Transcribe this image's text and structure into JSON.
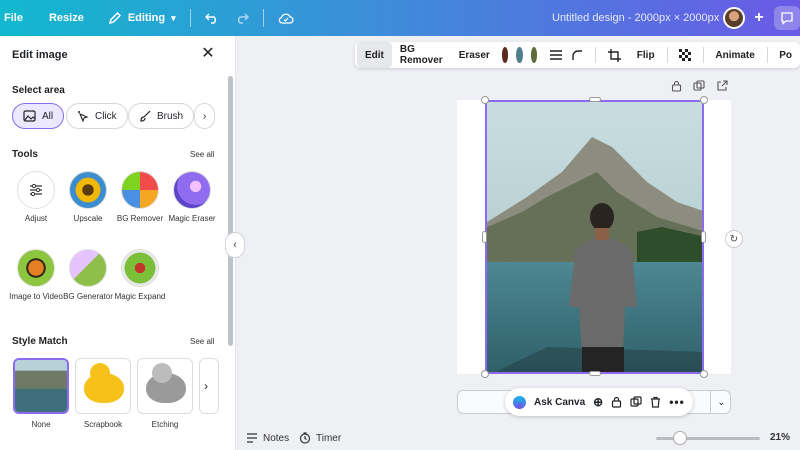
{
  "topbar": {
    "file": "File",
    "resize": "Resize",
    "editing": "Editing",
    "title": "Untitled design - 2000px × 2000px"
  },
  "panel": {
    "title": "Edit image",
    "select_area": {
      "heading": "Select area",
      "options": [
        "All",
        "Click",
        "Brush"
      ]
    },
    "tools": {
      "heading": "Tools",
      "see_all": "See all",
      "items": [
        {
          "label": "Adjust",
          "icon": "sliders-icon"
        },
        {
          "label": "Upscale",
          "icon": "sunflower-thumb"
        },
        {
          "label": "BG Remover",
          "icon": "ball-thumb"
        },
        {
          "label": "Magic Eraser",
          "icon": "eraser-thumb"
        },
        {
          "label": "Image to Video",
          "icon": "butterfly-thumb"
        },
        {
          "label": "BG Generator",
          "icon": "bg-gen-thumb"
        },
        {
          "label": "Magic Expand",
          "icon": "ladybug-thumb"
        }
      ]
    },
    "style_match": {
      "heading": "Style Match",
      "see_all": "See all",
      "items": [
        "None",
        "Scrapbook",
        "Etching"
      ]
    }
  },
  "context_toolbar": {
    "edit": "Edit",
    "bg_remover": "BG Remover",
    "eraser": "Eraser",
    "colors": [
      "#5a2a1e",
      "#4f7f8c",
      "#5f6b3a"
    ],
    "flip": "Flip",
    "animate": "Animate",
    "position": "Po"
  },
  "bottom": {
    "ask_canva": "Ask Canva",
    "notes": "Notes",
    "timer": "Timer",
    "zoom": "21%",
    "zoom_level": 0.21
  },
  "colors": {
    "accent": "#8b6cf0"
  }
}
